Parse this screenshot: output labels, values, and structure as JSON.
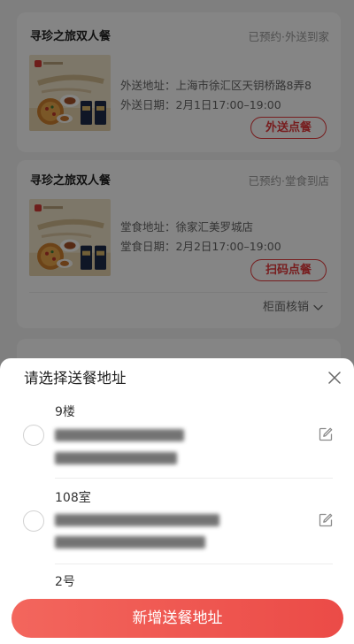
{
  "orders": [
    {
      "title": "寻珍之旅双人餐",
      "status": "已预约·外送到家",
      "address_label": "外送地址：",
      "address": "上海市徐汇区天钥桥路8弄8",
      "date_label": "外送日期：",
      "date": "2月1日17:00–19:00",
      "action_label": "外送点餐"
    },
    {
      "title": "寻珍之旅双人餐",
      "status": "已预约·堂食到店",
      "address_label": "堂食地址：",
      "address": "徐家汇美罗城店",
      "date_label": "堂食日期：",
      "date": "2月2日17:00–19:00",
      "action_label": "扫码点餐",
      "footer_toggle": "柜面核销"
    }
  ],
  "address_sheet": {
    "title": "请选择送餐地址",
    "addresses": [
      {
        "name": "9楼",
        "selected": false
      },
      {
        "name": "108室",
        "selected": false
      },
      {
        "name": "2号",
        "selected": false
      }
    ],
    "add_button_label": "新增送餐地址"
  },
  "icons": {
    "close": "close-icon",
    "edit": "edit-icon",
    "radio": "radio-unchecked-icon",
    "expand": "chevron-down-icon"
  },
  "colors": {
    "accent": "#e5383b",
    "add_button": "#ee5650",
    "mask": "rgba(0,0,0,0.48)"
  }
}
